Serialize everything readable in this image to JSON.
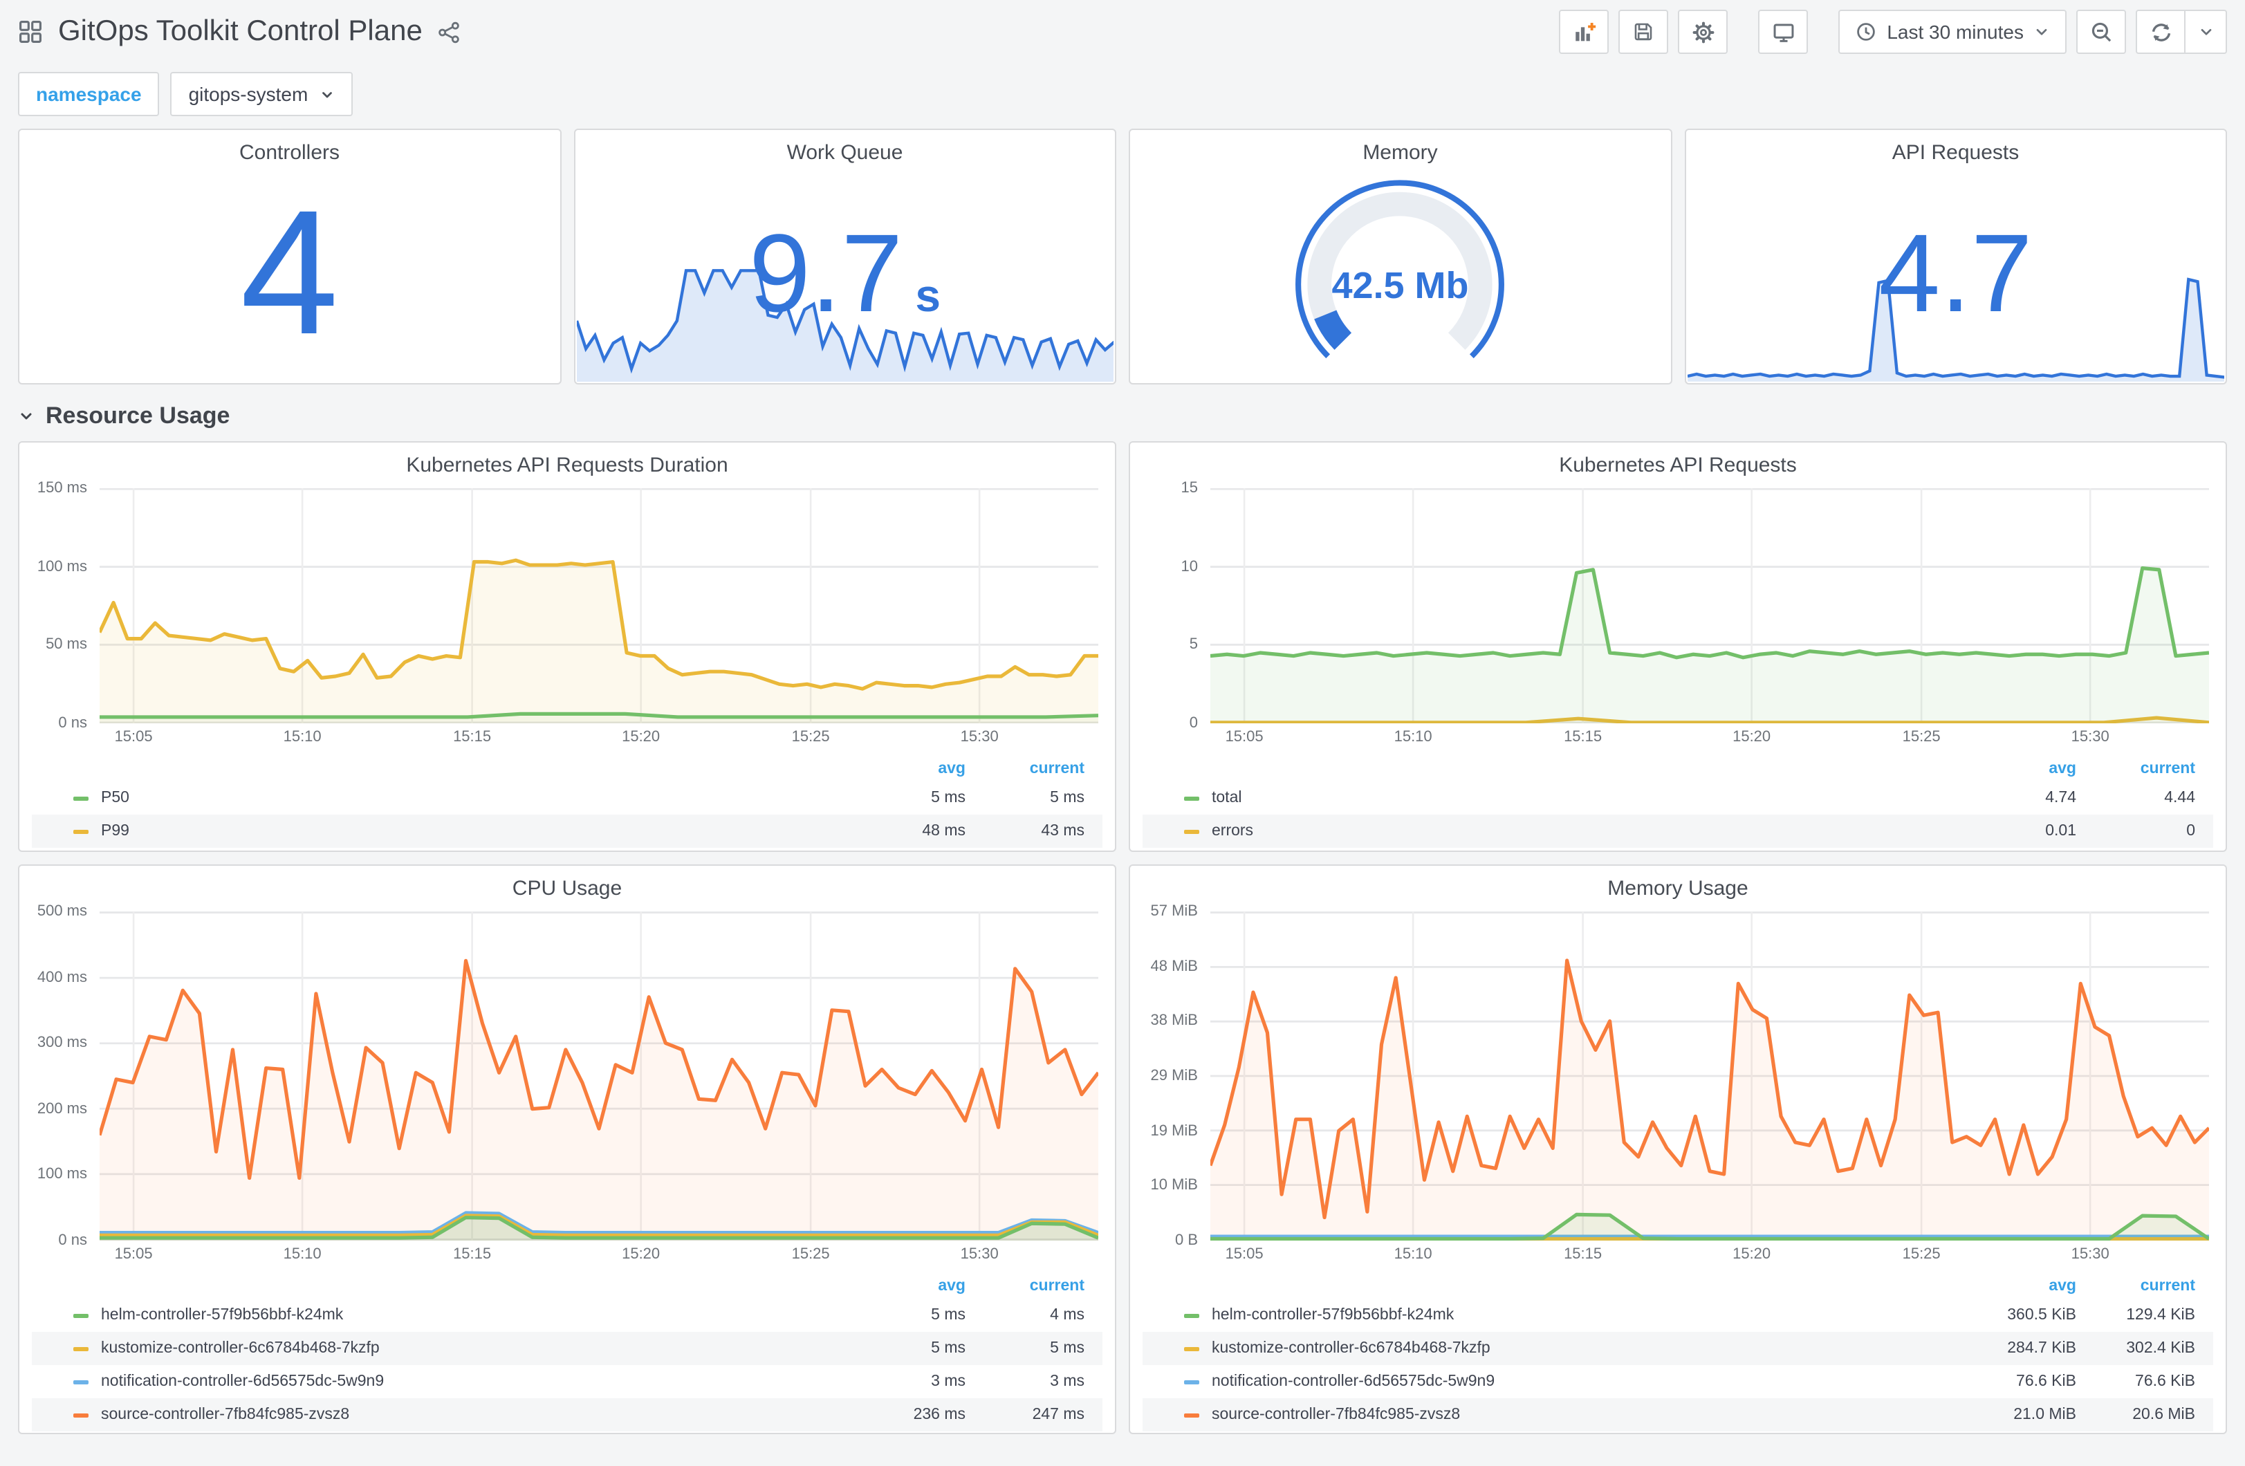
{
  "header": {
    "title": "GitOps Toolkit Control Plane",
    "time_range": "Last 30 minutes"
  },
  "variables": {
    "label": "namespace",
    "value": "gitops-system"
  },
  "stats": {
    "controllers": {
      "title": "Controllers",
      "value": "4"
    },
    "work_queue": {
      "title": "Work Queue",
      "value": "9.7",
      "unit": "s"
    },
    "memory": {
      "title": "Memory",
      "value": "42.5 Mb"
    },
    "api_requests": {
      "title": "API Requests",
      "value": "4.7"
    }
  },
  "section": {
    "title": "Resource Usage"
  },
  "legend_cols": {
    "avg": "avg",
    "current": "current"
  },
  "colors": {
    "accent_blue": "#3274d9",
    "link_blue": "#36a0e6",
    "green": "#73bf69",
    "yellow": "#eab839",
    "light_blue": "#6cb2e8",
    "orange": "#f87d3c"
  },
  "chart_data": [
    {
      "type": "line",
      "title": "Kubernetes API Requests Duration",
      "ylim": [
        0,
        150
      ],
      "yticks": [
        "150 ms",
        "100 ms",
        "50 ms",
        "0 ns"
      ],
      "xticks": [
        {
          "label": "15:05",
          "f": 0.034
        },
        {
          "label": "15:10",
          "f": 0.203
        },
        {
          "label": "15:15",
          "f": 0.373
        },
        {
          "label": "15:20",
          "f": 0.542
        },
        {
          "label": "15:25",
          "f": 0.712
        },
        {
          "label": "15:30",
          "f": 0.881
        }
      ],
      "legend_position": "bottom",
      "series": [
        {
          "name": "P50",
          "color": "#73bf69",
          "fill_opacity": 0.06,
          "avg": "5 ms",
          "current": "5 ms",
          "values": [
            4,
            4,
            4,
            4,
            4,
            4,
            4,
            4,
            6,
            6,
            6,
            4,
            4,
            4,
            4,
            4,
            4,
            4,
            4,
            5
          ]
        },
        {
          "name": "P99",
          "color": "#eab839",
          "fill_opacity": 0.09,
          "avg": "48 ms",
          "current": "43 ms",
          "values": [
            58,
            77,
            54,
            54,
            64,
            56,
            55,
            54,
            53,
            57,
            55,
            53,
            54,
            35,
            33,
            40,
            29,
            30,
            32,
            44,
            29,
            30,
            39,
            43,
            41,
            43,
            42,
            103,
            103,
            102,
            104,
            101,
            101,
            101,
            102,
            101,
            102,
            103,
            45,
            43,
            43,
            35,
            31,
            32,
            33,
            33,
            32,
            31,
            28,
            25,
            24,
            25,
            23,
            25,
            24,
            22,
            26,
            25,
            24,
            24,
            23,
            25,
            26,
            28,
            30,
            30,
            36,
            31,
            31,
            30,
            31,
            43,
            43
          ]
        }
      ]
    },
    {
      "type": "line",
      "title": "Kubernetes API Requests",
      "ylim": [
        0,
        15
      ],
      "yticks": [
        "15",
        "10",
        "5",
        "0"
      ],
      "xticks": [
        {
          "label": "15:05",
          "f": 0.034
        },
        {
          "label": "15:10",
          "f": 0.203
        },
        {
          "label": "15:15",
          "f": 0.373
        },
        {
          "label": "15:20",
          "f": 0.542
        },
        {
          "label": "15:25",
          "f": 0.712
        },
        {
          "label": "15:30",
          "f": 0.881
        }
      ],
      "legend_position": "bottom",
      "series": [
        {
          "name": "total",
          "color": "#73bf69",
          "fill_opacity": 0.09,
          "avg": "4.74",
          "current": "4.44",
          "values": [
            4.3,
            4.4,
            4.3,
            4.5,
            4.4,
            4.3,
            4.5,
            4.4,
            4.3,
            4.4,
            4.5,
            4.3,
            4.4,
            4.5,
            4.4,
            4.3,
            4.4,
            4.5,
            4.3,
            4.4,
            4.5,
            4.4,
            9.6,
            9.8,
            4.5,
            4.4,
            4.3,
            4.5,
            4.2,
            4.4,
            4.3,
            4.5,
            4.2,
            4.4,
            4.5,
            4.3,
            4.6,
            4.5,
            4.4,
            4.6,
            4.4,
            4.5,
            4.6,
            4.4,
            4.5,
            4.4,
            4.5,
            4.4,
            4.3,
            4.4,
            4.4,
            4.3,
            4.4,
            4.4,
            4.3,
            4.5,
            9.9,
            9.8,
            4.3,
            4.4,
            4.5
          ]
        },
        {
          "name": "errors",
          "color": "#eab839",
          "fill_opacity": 0.05,
          "avg": "0.01",
          "current": "0",
          "values": [
            0.05,
            0.05,
            0.05,
            0.05,
            0.05,
            0.05,
            0.05,
            0.3,
            0.05,
            0.05,
            0.05,
            0.05,
            0.05,
            0.05,
            0.05,
            0.05,
            0.05,
            0.05,
            0.35,
            0.05
          ]
        }
      ]
    },
    {
      "type": "line",
      "title": "CPU Usage",
      "ylim": [
        0,
        500
      ],
      "yticks": [
        "500 ms",
        "400 ms",
        "300 ms",
        "200 ms",
        "100 ms",
        "0 ns"
      ],
      "xticks": [
        {
          "label": "15:05",
          "f": 0.034
        },
        {
          "label": "15:10",
          "f": 0.203
        },
        {
          "label": "15:15",
          "f": 0.373
        },
        {
          "label": "15:20",
          "f": 0.542
        },
        {
          "label": "15:25",
          "f": 0.712
        },
        {
          "label": "15:30",
          "f": 0.881
        }
      ],
      "legend_position": "bottom",
      "series": [
        {
          "name": "helm-controller-57f9b56bbf-k24mk",
          "color": "#73bf69",
          "fill_opacity": 0.12,
          "avg": "5 ms",
          "current": "4 ms",
          "values": [
            4,
            4,
            4,
            4,
            4,
            4,
            4,
            4,
            4,
            4,
            5,
            35,
            34,
            5,
            4,
            4,
            4,
            4,
            4,
            4,
            4,
            4,
            4,
            4,
            4,
            4,
            4,
            4,
            26,
            25,
            4
          ]
        },
        {
          "name": "kustomize-controller-6c6784b468-7kzfp",
          "color": "#eab839",
          "fill_opacity": 0.08,
          "avg": "5 ms",
          "current": "5 ms",
          "values": [
            8,
            8,
            8,
            8,
            8,
            8,
            8,
            8,
            8,
            8,
            9,
            38,
            37,
            9,
            8,
            8,
            8,
            8,
            8,
            8,
            8,
            8,
            8,
            8,
            8,
            8,
            8,
            8,
            28,
            28,
            8
          ]
        },
        {
          "name": "notification-controller-6d56575dc-5w9n9",
          "color": "#6cb2e8",
          "fill_opacity": 0.08,
          "avg": "3 ms",
          "current": "3 ms",
          "values": [
            12,
            12,
            12,
            12,
            12,
            12,
            12,
            12,
            12,
            12,
            13,
            42,
            41,
            13,
            12,
            12,
            12,
            12,
            12,
            12,
            12,
            12,
            12,
            12,
            12,
            12,
            12,
            12,
            31,
            30,
            12
          ]
        },
        {
          "name": "source-controller-7fb84fc985-zvsz8",
          "color": "#f87d3c",
          "fill_opacity": 0.07,
          "avg": "236 ms",
          "current": "247 ms",
          "values": [
            160,
            245,
            240,
            310,
            305,
            380,
            345,
            135,
            290,
            95,
            262,
            260,
            95,
            375,
            255,
            150,
            293,
            270,
            140,
            255,
            240,
            165,
            425,
            330,
            255,
            310,
            200,
            202,
            290,
            240,
            170,
            267,
            255,
            370,
            300,
            290,
            215,
            213,
            275,
            240,
            170,
            255,
            252,
            205,
            350,
            348,
            235,
            260,
            232,
            222,
            258,
            225,
            182,
            260,
            172,
            413,
            378,
            270,
            290,
            222,
            255
          ]
        }
      ]
    },
    {
      "type": "line",
      "title": "Memory Usage",
      "ylim": [
        0,
        57
      ],
      "yticks": [
        "57 MiB",
        "48 MiB",
        "38 MiB",
        "29 MiB",
        "19 MiB",
        "10 MiB",
        "0 B"
      ],
      "xticks": [
        {
          "label": "15:05",
          "f": 0.034
        },
        {
          "label": "15:10",
          "f": 0.203
        },
        {
          "label": "15:15",
          "f": 0.373
        },
        {
          "label": "15:20",
          "f": 0.542
        },
        {
          "label": "15:25",
          "f": 0.712
        },
        {
          "label": "15:30",
          "f": 0.881
        }
      ],
      "legend_position": "bottom",
      "series": [
        {
          "name": "helm-controller-57f9b56bbf-k24mk",
          "color": "#73bf69",
          "fill_opacity": 0.12,
          "avg": "360.5 KiB",
          "current": "129.4 KiB",
          "values": [
            0.3,
            0.3,
            0.3,
            0.3,
            0.3,
            0.3,
            0.3,
            0.3,
            0.3,
            0.3,
            0.4,
            4.5,
            4.4,
            0.4,
            0.3,
            0.3,
            0.3,
            0.3,
            0.3,
            0.3,
            0.3,
            0.3,
            0.3,
            0.3,
            0.3,
            0.3,
            0.3,
            0.3,
            4.3,
            4.2,
            0.3
          ]
        },
        {
          "name": "kustomize-controller-6c6784b468-7kzfp",
          "color": "#eab839",
          "fill_opacity": 0.08,
          "avg": "284.7 KiB",
          "current": "302.4 KiB",
          "values": [
            0.28,
            0.28,
            0.28,
            0.28,
            0.28,
            0.28,
            0.28,
            0.28
          ]
        },
        {
          "name": "notification-controller-6d56575dc-5w9n9",
          "color": "#6cb2e8",
          "fill_opacity": 0.08,
          "avg": "76.6 KiB",
          "current": "76.6 KiB",
          "values": [
            0.7,
            0.7,
            0.7,
            0.7,
            0.7,
            0.7,
            0.7,
            0.7
          ]
        },
        {
          "name": "source-controller-7fb84fc985-zvsz8",
          "color": "#f87d3c",
          "fill_opacity": 0.07,
          "avg": "21.0 MiB",
          "current": "20.6 MiB",
          "values": [
            13,
            20,
            30,
            43,
            36,
            8,
            21,
            21,
            4,
            19,
            21,
            5,
            34,
            45.5,
            28,
            10.5,
            20.5,
            12,
            21.5,
            13,
            12.5,
            21.5,
            16,
            21,
            16,
            48.5,
            38,
            33,
            38,
            17,
            14.5,
            20.5,
            16,
            13,
            21.5,
            12,
            11.5,
            44.5,
            40,
            38.5,
            21.5,
            17,
            16.5,
            21,
            12,
            12.5,
            21,
            13,
            21,
            42.5,
            39,
            39.5,
            17,
            18,
            16.5,
            21,
            11.5,
            20,
            11.5,
            14.5,
            21,
            44.5,
            37,
            35.5,
            25,
            18,
            19.5,
            16.5,
            21.5,
            17,
            19.5
          ]
        }
      ]
    },
    {
      "type": "area-spark",
      "title": "Work Queue",
      "ylim": [
        0,
        10.2
      ],
      "color": "#3274d9",
      "fill_opacity": 0.16,
      "values": [
        5.5,
        3.0,
        4.2,
        2.0,
        3.5,
        4.0,
        1.2,
        3.5,
        2.8,
        3.3,
        4.2,
        5.5,
        10,
        10,
        8,
        10,
        10,
        8.5,
        10,
        10,
        10,
        6,
        5.8,
        7,
        4.5,
        6.5,
        7,
        3.2,
        5.2,
        4.0,
        1.5,
        4.8,
        3.0,
        1.6,
        4.6,
        4.4,
        1.4,
        4.4,
        4.2,
        2.1,
        4.5,
        1.5,
        4.3,
        4.4,
        1.6,
        4.2,
        4.0,
        1.8,
        4.0,
        3.8,
        1.5,
        3.6,
        3.9,
        1.4,
        3.4,
        3.7,
        1.7,
        3.8,
        2.9,
        3.6
      ]
    },
    {
      "type": "area-spark",
      "title": "API Requests",
      "ylim": [
        0,
        10
      ],
      "color": "#3274d9",
      "fill_opacity": 0.16,
      "values": [
        0.5,
        0.7,
        0.5,
        0.6,
        0.5,
        0.7,
        0.5,
        0.6,
        0.7,
        0.5,
        0.6,
        0.5,
        0.7,
        0.5,
        0.6,
        0.5,
        0.7,
        0.6,
        0.5,
        0.6,
        1.0,
        9.3,
        9.5,
        0.8,
        0.5,
        0.6,
        0.5,
        0.7,
        0.5,
        0.6,
        0.7,
        0.5,
        0.6,
        0.7,
        0.5,
        0.6,
        0.5,
        0.7,
        0.5,
        0.6,
        0.5,
        0.7,
        0.6,
        0.5,
        0.6,
        0.5,
        0.7,
        0.5,
        0.6,
        0.5,
        0.7,
        0.5,
        0.6,
        0.5,
        0.5,
        9.6,
        9.4,
        0.6,
        0.5,
        0.4
      ]
    },
    {
      "type": "gauge",
      "title": "Memory",
      "value": "42.5 Mb",
      "fraction": 0.085,
      "track_color": "#e9edf2",
      "value_color": "#3274d9"
    }
  ]
}
